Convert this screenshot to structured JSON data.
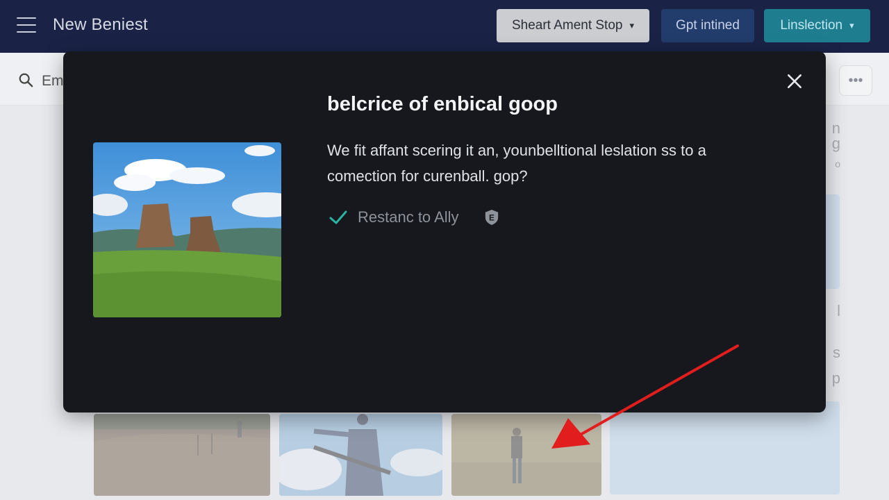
{
  "header": {
    "title": "New Beniest",
    "select_label": "Sheart Ament Stop",
    "primary_label": "Gpt intined",
    "secondary_label": "Linslection"
  },
  "background": {
    "search_text": "Em",
    "side_fragments": [
      "n",
      "g",
      "o",
      "l",
      "s",
      "p"
    ]
  },
  "modal": {
    "title": "belcrice of enbical goop",
    "body": "We fit affant scering it an, younbelltional leslation ss to a comection for curenball. gop?",
    "check_label": "Restanc to Ally",
    "badge_char": "E"
  },
  "icons": {
    "menu": "hamburger-icon",
    "search": "search-icon",
    "close": "close-icon",
    "check": "check-icon",
    "badge": "shield-badge-icon",
    "more": "more-horizontal-icon",
    "arrow": "red-arrow-annotation"
  },
  "colors": {
    "header_bg": "#1a2346",
    "modal_bg": "#16181d",
    "teal_accent": "#1e7e90",
    "check_color": "#2bb3a3",
    "annotation_red": "#e11d1d"
  }
}
